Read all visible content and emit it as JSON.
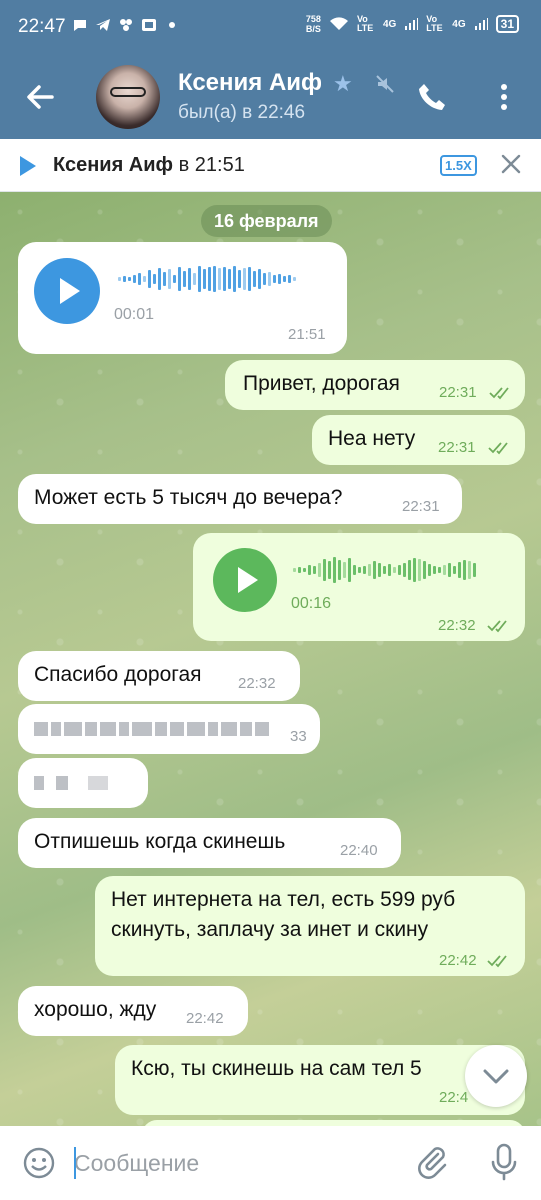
{
  "status_bar": {
    "time": "22:47",
    "net_speed_value": "758",
    "net_speed_unit": "B/S",
    "volte1": "Vo LTE",
    "sig1": "4G",
    "volte2": "Vo LTE",
    "sig2": "4G",
    "battery": "31"
  },
  "header": {
    "name": "Ксения Аиф",
    "status": "был(а) в 22:46"
  },
  "player": {
    "title_name": "Ксения Аиф",
    "title_suffix": " в 21:51",
    "speed": "1.5X"
  },
  "chat": {
    "date": "16 февраля",
    "messages": [
      {
        "dir": "in",
        "type": "voice",
        "duration": "00:01",
        "time": "21:51"
      },
      {
        "dir": "out",
        "text": "Привет, дорогая",
        "time": "22:31"
      },
      {
        "dir": "out",
        "text": "Неа нету",
        "time": "22:31"
      },
      {
        "dir": "in",
        "text": "Может есть 5 тысяч до вечера?",
        "time": "22:31"
      },
      {
        "dir": "out",
        "type": "voice",
        "duration": "00:16",
        "time": "22:32"
      },
      {
        "dir": "in",
        "text": "Спасибо дорогая",
        "time": "22:32"
      },
      {
        "dir": "in",
        "type": "redacted",
        "time": "33"
      },
      {
        "dir": "in",
        "type": "redacted"
      },
      {
        "dir": "in",
        "text": "Отпишешь когда скинешь",
        "time": "22:40"
      },
      {
        "dir": "out",
        "text_line1": "Нет интернета на тел, есть 599 руб",
        "text_line2": "скинуть, заплачу за инет и скину",
        "time": "22:42"
      },
      {
        "dir": "in",
        "text": "хорошо, жду",
        "time": "22:42"
      },
      {
        "dir": "out",
        "text": "Ксю, ты скинешь на сам тел 5",
        "time": "22:4"
      }
    ]
  },
  "input": {
    "placeholder": "Сообщение"
  },
  "colors": {
    "header_bg": "#517da2",
    "accent": "#3d97e0",
    "out_bubble": "#effedd",
    "in_bubble": "#ffffff",
    "voice_play_in": "#3d97e0",
    "voice_play_out": "#5cb85c",
    "read_ticks": "#6fac5b"
  }
}
